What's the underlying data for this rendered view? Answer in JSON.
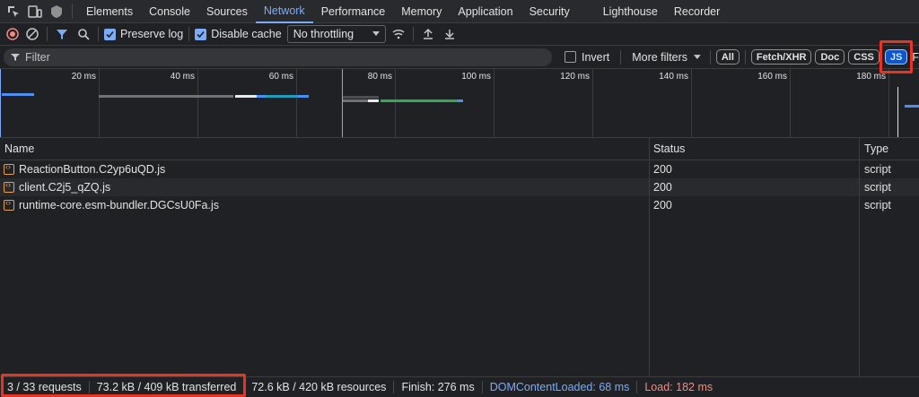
{
  "tabs": [
    {
      "label": "Elements",
      "active": false
    },
    {
      "label": "Console",
      "active": false
    },
    {
      "label": "Sources",
      "active": false
    },
    {
      "label": "Network",
      "active": true
    },
    {
      "label": "Performance",
      "active": false
    },
    {
      "label": "Memory",
      "active": false
    },
    {
      "label": "Application",
      "active": false
    },
    {
      "label": "Security",
      "active": false
    },
    {
      "label": "Lighthouse",
      "active": false
    },
    {
      "label": "Recorder",
      "active": false
    }
  ],
  "toolbar": {
    "preserve_log": "Preserve log",
    "disable_cache": "Disable cache",
    "throttling": "No throttling"
  },
  "filter": {
    "placeholder": "Filter",
    "invert": "Invert",
    "more_filters": "More filters",
    "chips": [
      {
        "label": "All",
        "active": false
      },
      {
        "label": "Fetch/XHR",
        "active": false
      },
      {
        "label": "Doc",
        "active": false
      },
      {
        "label": "CSS",
        "active": false
      },
      {
        "label": "JS",
        "active": true
      },
      {
        "label": "F",
        "active": false
      }
    ]
  },
  "overview": {
    "ticks": [
      "20 ms",
      "40 ms",
      "60 ms",
      "80 ms",
      "100 ms",
      "120 ms",
      "140 ms",
      "160 ms",
      "180 ms"
    ]
  },
  "table": {
    "headers": {
      "name": "Name",
      "status": "Status",
      "type": "Type"
    },
    "rows": [
      {
        "name": "ReactionButton.C2yp6uQD.js",
        "status": "200",
        "type": "script"
      },
      {
        "name": "client.C2j5_qZQ.js",
        "status": "200",
        "type": "script"
      },
      {
        "name": "runtime-core.esm-bundler.DGCsU0Fa.js",
        "status": "200",
        "type": "script"
      }
    ]
  },
  "statusbar": {
    "requests": "3 / 33 requests",
    "transferred": "73.2 kB / 409 kB transferred",
    "resources": "72.6 kB / 420 kB resources",
    "finish": "Finish: 276 ms",
    "dcl": "DOMContentLoaded: 68 ms",
    "load": "Load: 182 ms"
  },
  "colors": {
    "dcl": "#7cacf8",
    "load": "#f28b82",
    "accent": "#7cacf8",
    "highlight": "#ea3323"
  }
}
